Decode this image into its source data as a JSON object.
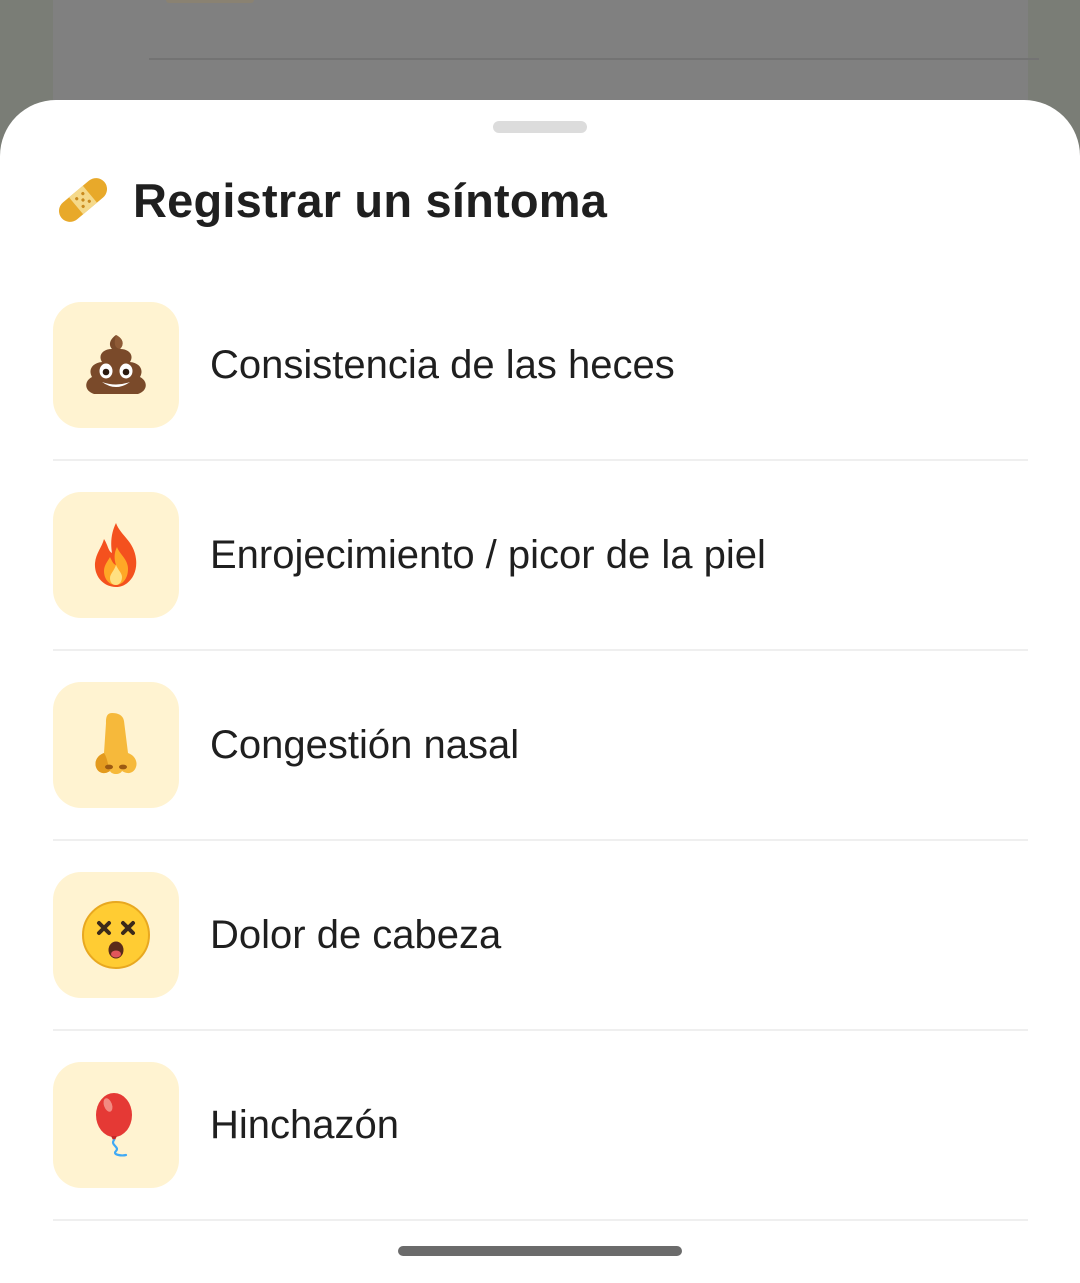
{
  "sheet": {
    "title": "Registrar un síntoma",
    "title_icon": "bandage-icon"
  },
  "symptoms": [
    {
      "label": "Consistencia de las heces",
      "icon": "poop-icon"
    },
    {
      "label": "Enrojecimiento / picor de la piel",
      "icon": "fire-icon"
    },
    {
      "label": "Congestión nasal",
      "icon": "nose-icon"
    },
    {
      "label": "Dolor de cabeza",
      "icon": "dizzy-face-icon"
    },
    {
      "label": "Hinchazón",
      "icon": "balloon-icon"
    }
  ],
  "colors": {
    "tile_background": "#FFF3D1",
    "text": "#1F1F1F",
    "divider": "#EFEFEF",
    "scrim": "#7F7F7F"
  }
}
